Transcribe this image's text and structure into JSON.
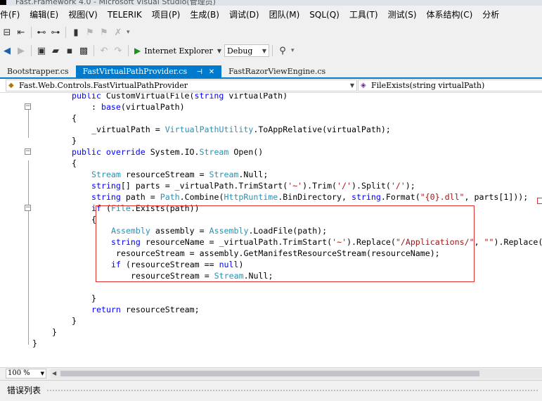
{
  "window": {
    "title": "Fast.Framework 4.0 - Microsoft Visual Studio(管理员)"
  },
  "menu": [
    "件(F)",
    "编辑(E)",
    "视图(V)",
    "TELERIK",
    "项目(P)",
    "生成(B)",
    "调试(D)",
    "团队(M)",
    "SQL(Q)",
    "工具(T)",
    "测试(S)",
    "体系结构(C)",
    "分析"
  ],
  "toolbar": {
    "run_label": "Internet Explorer",
    "config_value": "Debug"
  },
  "tabs": [
    {
      "label": "Bootstrapper.cs",
      "active": false
    },
    {
      "label": "FastVirtualPathProvider.cs",
      "active": true
    },
    {
      "label": "FastRazorViewEngine.cs",
      "active": false
    }
  ],
  "navbar": {
    "class_value": "Fast.Web.Controls.FastVirtualPathProvider",
    "member_value": "FileExists(string virtualPath)"
  },
  "code": {
    "l0a": "public",
    "l0b": "CustomVirtualFile(",
    "l0c": "string",
    "l0d": " virtualPath)",
    "l1a": ": ",
    "l1b": "base",
    "l1c": "(virtualPath)",
    "l2": "{",
    "l3a": "_virtualPath = ",
    "l3b": "VirtualPathUtility",
    "l3c": ".ToAppRelative(virtualPath);",
    "l4": "}",
    "l5a": "public",
    "l5b": "override",
    "l5c": "System.IO.",
    "l5d": "Stream",
    "l5e": " Open()",
    "l6": "{",
    "l7a": "Stream",
    "l7b": " resourceStream = ",
    "l7c": "Stream",
    "l7d": ".Null;",
    "l8a": "string",
    "l8b": "[] parts = _virtualPath.TrimStart(",
    "l8c": "'~'",
    "l8d": ").Trim(",
    "l8e": "'/'",
    "l8f": ").Split(",
    "l8g": "'/'",
    "l8h": ");",
    "l9a": "string",
    "l9b": " path = ",
    "l9c": "Path",
    "l9d": ".Combine(",
    "l9e": "HttpRuntime",
    "l9f": ".BinDirectory, ",
    "l9g": "string",
    "l9h": ".Format(",
    "l9i": "\"{0}.dll\"",
    "l9j": ", parts[1]));",
    "l10a": "if",
    "l10b": " (",
    "l10c": "File",
    "l10d": ".Exists(path))",
    "l11": "{",
    "l12a": "Assembly",
    "l12b": " assembly = ",
    "l12c": "Assembly",
    "l12d": ".LoadFile(path);",
    "l13a": "string",
    "l13b": " resourceName = _virtualPath.TrimStart(",
    "l13c": "'~'",
    "l13d": ").Replace(",
    "l13e": "\"/Applications/\"",
    "l13f": ", ",
    "l13g": "\"\"",
    "l13h": ").Replace(",
    "l14": " resourceStream = assembly.GetManifestResourceStream(resourceName);",
    "l15a": "if",
    "l15b": " (resourceStream == ",
    "l15c": "null",
    "l15d": ")",
    "l16a": "resourceStream = ",
    "l16b": "Stream",
    "l16c": ".Null;",
    "l17": "}",
    "l18a": "return",
    "l18b": " resourceStream;",
    "l19": "}",
    "l20": "}",
    "l21": "}"
  },
  "zoom": "100 %",
  "bottom_panel": {
    "title": "错误列表"
  },
  "colors": {
    "accent": "#007acc",
    "keyword": "#0000ff",
    "type": "#2b91af",
    "string": "#a31515",
    "highlight_box": "#e03030"
  }
}
